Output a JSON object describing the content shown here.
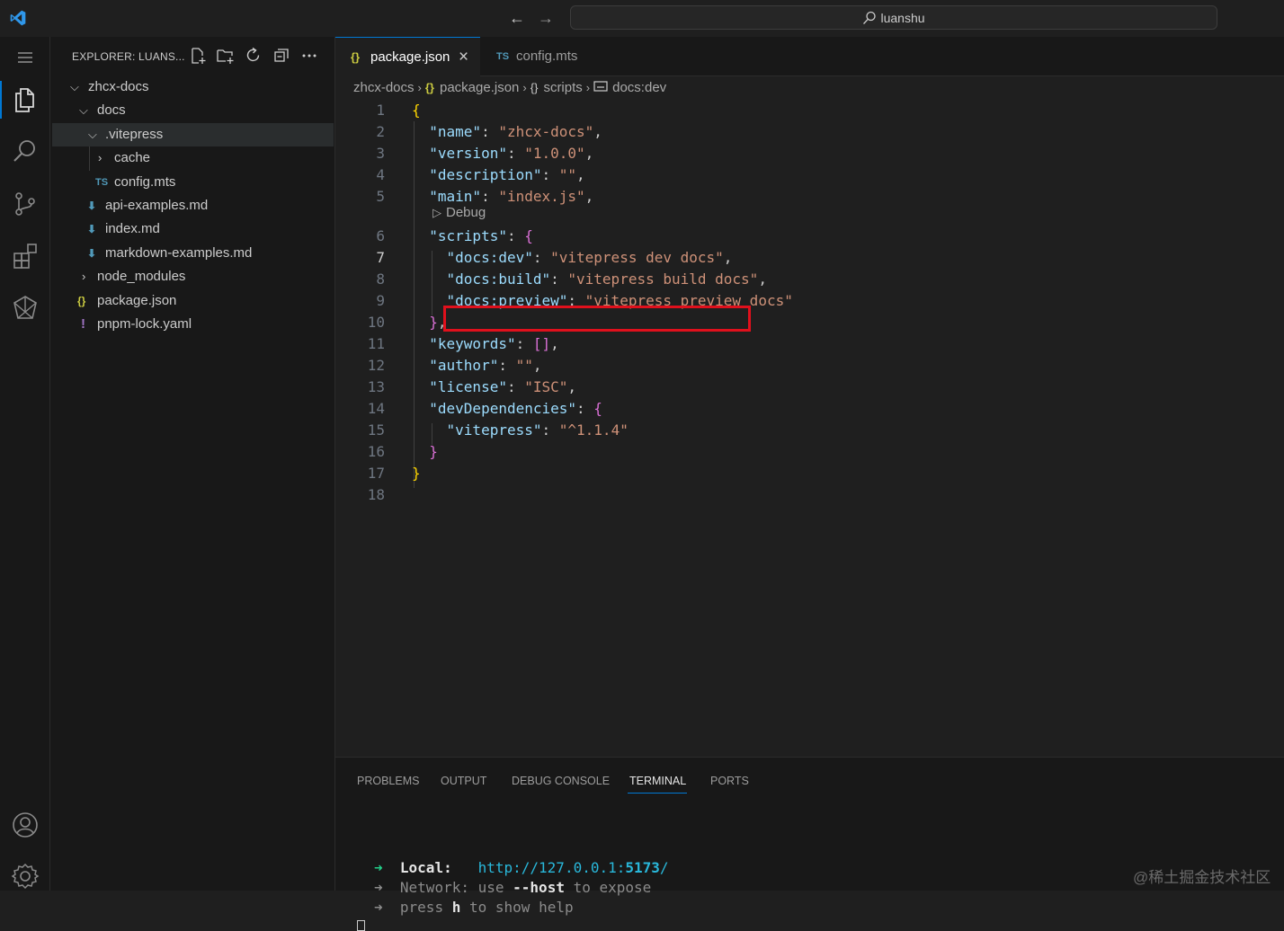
{
  "titlebar": {
    "search_text": "luanshu",
    "back_icon": "arrow-left-icon",
    "forward_icon": "arrow-right-icon"
  },
  "sidebar": {
    "title": "EXPLORER: LUANS...",
    "tree": [
      {
        "label": "zhcx-docs",
        "type": "folder",
        "expanded": true,
        "depth": 0
      },
      {
        "label": "docs",
        "type": "folder",
        "expanded": true,
        "depth": 1
      },
      {
        "label": ".vitepress",
        "type": "folder",
        "expanded": true,
        "depth": 2,
        "selected": true
      },
      {
        "label": "cache",
        "type": "folder",
        "expanded": false,
        "depth": 3
      },
      {
        "label": "config.mts",
        "type": "ts",
        "depth": 3,
        "badge": "TS"
      },
      {
        "label": "api-examples.md",
        "type": "md",
        "depth": 2
      },
      {
        "label": "index.md",
        "type": "md",
        "depth": 2
      },
      {
        "label": "markdown-examples.md",
        "type": "md",
        "depth": 2
      },
      {
        "label": "node_modules",
        "type": "folder",
        "expanded": false,
        "depth": 1
      },
      {
        "label": "package.json",
        "type": "json",
        "depth": 1,
        "badge": "{}"
      },
      {
        "label": "pnpm-lock.yaml",
        "type": "yaml",
        "depth": 1,
        "badge": "!"
      }
    ]
  },
  "tabs": [
    {
      "label": "package.json",
      "badge": "{}",
      "active": true,
      "close": "×"
    },
    {
      "label": "config.mts",
      "badge": "TS",
      "active": false
    }
  ],
  "breadcrumb": {
    "root": "zhcx-docs",
    "file": "package.json",
    "file_badge": "{}",
    "section": "scripts",
    "section_badge": "{}",
    "leaf": "docs:dev"
  },
  "code": {
    "debug_lens": "Debug",
    "lines": [
      "1",
      "2",
      "3",
      "4",
      "5",
      "6",
      "7",
      "8",
      "9",
      "10",
      "11",
      "12",
      "13",
      "14",
      "15",
      "16",
      "17",
      "18"
    ],
    "active_line": 7
  },
  "panel": {
    "tabs": [
      "PROBLEMS",
      "OUTPUT",
      "DEBUG CONSOLE",
      "TERMINAL",
      "PORTS"
    ],
    "active_tab": "TERMINAL",
    "terminal": {
      "local_label": "Local:",
      "local_url_prefix": "http://127.0.0.1:",
      "local_port": "5173",
      "local_url_suffix": "/",
      "network_label": "Network:",
      "network_text_1": "use",
      "network_flag": "--host",
      "network_text_2": "to expose",
      "press_text": "press",
      "press_key": "h",
      "press_rest": "to show help",
      "arrow": "➜"
    }
  },
  "watermark": "@稀土掘金技术社区",
  "colors": {
    "accent": "#0078d4",
    "highlight_box": "#e0101c",
    "json_key": "#9cdcfe",
    "json_string": "#ce9178"
  }
}
